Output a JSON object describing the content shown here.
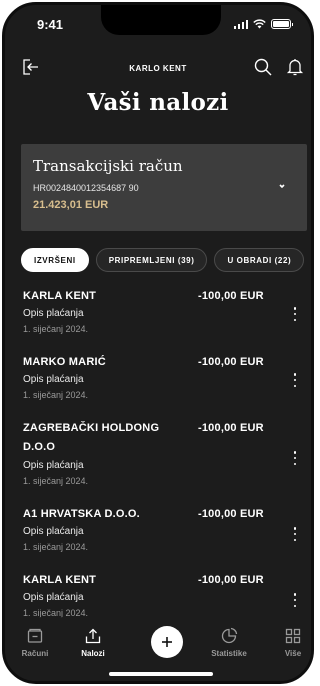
{
  "status_bar": {
    "time": "9:41"
  },
  "header": {
    "user_name": "KARLO KENT",
    "title": "Vaši nalozi"
  },
  "account": {
    "name": "Transakcijski račun",
    "iban": "HR0024840012354687 90",
    "balance": "21.423,01 EUR"
  },
  "tabs": [
    {
      "label": "IZVRŠENI",
      "active": true
    },
    {
      "label": "PRIPREMLJENI (39)",
      "active": false
    },
    {
      "label": "U OBRADI (22)",
      "active": false
    }
  ],
  "orders": [
    {
      "name": "KARLA KENT",
      "amount": "-100,00 EUR",
      "description": "Opis plaćanja",
      "date": "1. siječanj 2024."
    },
    {
      "name": "MARKO MARIĆ",
      "amount": "-100,00 EUR",
      "description": "Opis plaćanja",
      "date": "1. siječanj 2024."
    },
    {
      "name": "ZAGREBAČKI HOLDONG D.O.O",
      "amount": "-100,00 EUR",
      "description": "Opis plaćanja",
      "date": "1. siječanj 2024."
    },
    {
      "name": "A1 HRVATSKA D.O.O.",
      "amount": "-100,00 EUR",
      "description": "Opis plaćanja",
      "date": "1. siječanj 2024."
    },
    {
      "name": "KARLA KENT",
      "amount": "-100,00 EUR",
      "description": "Opis plaćanja",
      "date": "1. siječanj 2024."
    }
  ],
  "bottom_nav": {
    "items": [
      {
        "label": "Računi",
        "icon": "wallet-icon",
        "active": false
      },
      {
        "label": "Nalozi",
        "icon": "upload-icon",
        "active": true
      },
      {
        "label": "Statistike",
        "icon": "pie-chart-icon",
        "active": false
      },
      {
        "label": "Više",
        "icon": "grid-icon",
        "active": false
      }
    ],
    "fab_icon": "plus-icon"
  },
  "colors": {
    "background": "#1c1c1c",
    "card": "#3d3d3d",
    "accent_gold": "#d8be8e"
  }
}
